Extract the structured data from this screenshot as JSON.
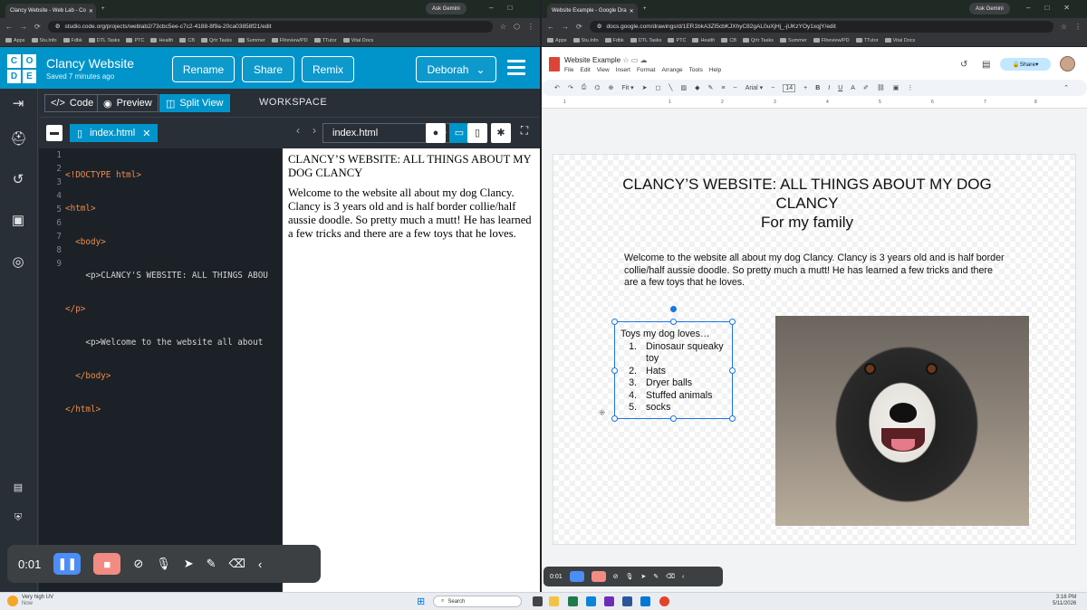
{
  "left_browser": {
    "tab_title": "Clancy Website - Web Lab - Co",
    "ask_gemini": "Ask Gemini",
    "url": "studio.code.org/projects/weblab2/73cbc5ee-c7c2-4188-8f9a-20ca03858f21/edit",
    "bookmarks": [
      "Apps",
      "Stu.Info",
      "Fdbk",
      "DTL Tasks",
      "PTC",
      "Health",
      "CB",
      "Qrtr Tasks",
      "Summer",
      "Fllreview/PD",
      "TTutor",
      "Vital Docs"
    ]
  },
  "code_studio": {
    "logo_letters": [
      "C",
      "O",
      "D",
      "E"
    ],
    "project_title": "Clancy Website",
    "saved_status": "Saved 7 minutes ago",
    "header_buttons": {
      "rename": "Rename",
      "share": "Share",
      "remix": "Remix"
    },
    "user_menu": "Deborah",
    "view_buttons": {
      "code": "Code",
      "preview": "Preview",
      "split": "Split View"
    },
    "workspace_label": "WORKSPACE",
    "file_tab": "index.html",
    "preview_url": "index.html",
    "code_lines": [
      "<!DOCTYPE html>",
      "<html>",
      "  <body>",
      "    <p>CLANCY'S WEBSITE: ALL THINGS ABOU",
      "</p>",
      "    <p>Welcome to the website all about",
      "  </body>",
      "</html>",
      ""
    ],
    "preview_paragraphs": [
      "CLANCY’S WEBSITE: ALL THINGS ABOUT MY DOG CLANCY",
      "Welcome to the website all about my dog Clancy. Clancy is 3 years old and is half border collie/half aussie doodle. So pretty much a mutt! He has learned a few tricks and there are a few toys that he loves."
    ]
  },
  "recorder_left": {
    "time": "0:01"
  },
  "right_browser": {
    "tab_title": "Website Example - Google Dra",
    "ask_gemini": "Ask Gemini",
    "url": "docs.google.com/drawings/d/1ER1bkA3Zl5cbKJXhyC82gAL0uXjHj_-jUKzYOy1xqjY/edit",
    "bookmarks": [
      "Apps",
      "Stu.Info",
      "Fdbk",
      "DTL Tasks",
      "PTC",
      "Health",
      "CB",
      "Qrtr Tasks",
      "Summer",
      "Fllreview/PD",
      "TTutor",
      "Vital Docs"
    ]
  },
  "drawing": {
    "doc_title": "Website Example",
    "menu": [
      "File",
      "Edit",
      "View",
      "Insert",
      "Format",
      "Arrange",
      "Tools",
      "Help"
    ],
    "share": "Share",
    "zoom": "Fit",
    "font": "Arial",
    "font_size": "14",
    "ruler_marks": [
      "1",
      "1",
      "2",
      "3",
      "4",
      "5",
      "6",
      "7",
      "8"
    ],
    "heading_line1": "CLANCY’S WEBSITE: ALL THINGS ABOUT MY DOG",
    "heading_line2": "CLANCY",
    "heading_line3": "For my family",
    "paragraph": "Welcome to the website all about my dog Clancy. Clancy is 3 years old and is half border collie/half aussie doodle. So pretty much a mutt! He has learned a few tricks and there are a few toys that he loves.",
    "list_title": "Toys my dog loves…",
    "toys": [
      {
        "n": "1.",
        "text": "Dinosaur squeaky toy"
      },
      {
        "n": "2.",
        "text": "Hats"
      },
      {
        "n": "3.",
        "text": "Dryer balls"
      },
      {
        "n": "4.",
        "text": "Stuffed animals"
      },
      {
        "n": "5.",
        "text": "socks"
      }
    ]
  },
  "recorder_right": {
    "time": "0:01"
  },
  "taskbar": {
    "weather_line1": "Very high UV",
    "weather_line2": "Now",
    "search": "Search",
    "time": "3:16 PM",
    "date": "5/11/2026"
  }
}
